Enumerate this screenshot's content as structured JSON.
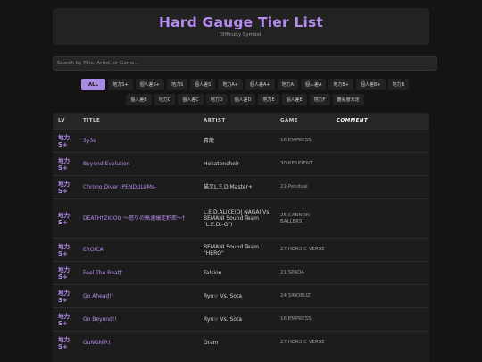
{
  "header": {
    "title": "Hard Gauge Tier List",
    "subtitle": "Difficulty Symbol:"
  },
  "search": {
    "placeholder": "Search by Title, Artist, or Game..."
  },
  "filters": {
    "row1": [
      "ALL",
      "地力S+",
      "個人差S+",
      "地力S",
      "個人差S",
      "地力A+",
      "個人差A+",
      "地力A",
      "個人差A",
      "地力B+",
      "個人差B+",
      "地力B"
    ],
    "row2": [
      "個人差B",
      "地力C",
      "個人差C",
      "地力D",
      "個人差D",
      "地力E",
      "個人差E",
      "地力F",
      "難易度未定"
    ],
    "active": "ALL"
  },
  "table": {
    "headers": {
      "lv": "LV",
      "title": "TITLE",
      "artist": "ARTIST",
      "game": "GAME",
      "comment": "COMMENT"
    },
    "rows": [
      {
        "lv_kanji": "地力",
        "lv_grade": "S+",
        "title": "3y3s",
        "artist": "青龍",
        "game": "16 EMPRESS",
        "comment": ""
      },
      {
        "lv_kanji": "地力",
        "lv_grade": "S+",
        "title": "Beyond Evolution",
        "artist": "Hekatoncheir",
        "game": "30 RESIDENT",
        "comment": ""
      },
      {
        "lv_kanji": "地力",
        "lv_grade": "S+",
        "title": "Chrono Diver -PENDULUMs-",
        "artist": "猫叉L.E.D.Master+",
        "game": "22 Pendual",
        "comment": ""
      },
      {
        "lv_kanji": "地力",
        "lv_grade": "S+",
        "title": "DEATH†ZIGOQ ～怒りの高速爆走野郎～†",
        "artist": "L.E.D.ALiCE(DJ NAGAI Vs. BEMANI Sound Team \"L.E.D.-G\")",
        "game": "25 CANNON BALLERS",
        "comment": ""
      },
      {
        "lv_kanji": "地力",
        "lv_grade": "S+",
        "title": "EROICA",
        "artist": "BEMANI Sound Team \"HERO\"",
        "game": "27 HEROIC VERSE",
        "comment": ""
      },
      {
        "lv_kanji": "地力",
        "lv_grade": "S+",
        "title": "Feel The Beat†",
        "artist": "Falsion",
        "game": "21 SPADA",
        "comment": ""
      },
      {
        "lv_kanji": "地力",
        "lv_grade": "S+",
        "title": "Go Ahead!!",
        "artist": "Ryu☆ Vs. Sota",
        "game": "24 SINOBUZ",
        "comment": ""
      },
      {
        "lv_kanji": "地力",
        "lv_grade": "S+",
        "title": "Go Beyond!!",
        "artist": "Ryu☆ Vs. Sota",
        "game": "16 EMPRESS",
        "comment": ""
      },
      {
        "lv_kanji": "地力",
        "lv_grade": "S+",
        "title": "GuNGNiR†",
        "artist": "Gram",
        "game": "27 HEROIC VERSE",
        "comment": ""
      }
    ]
  }
}
